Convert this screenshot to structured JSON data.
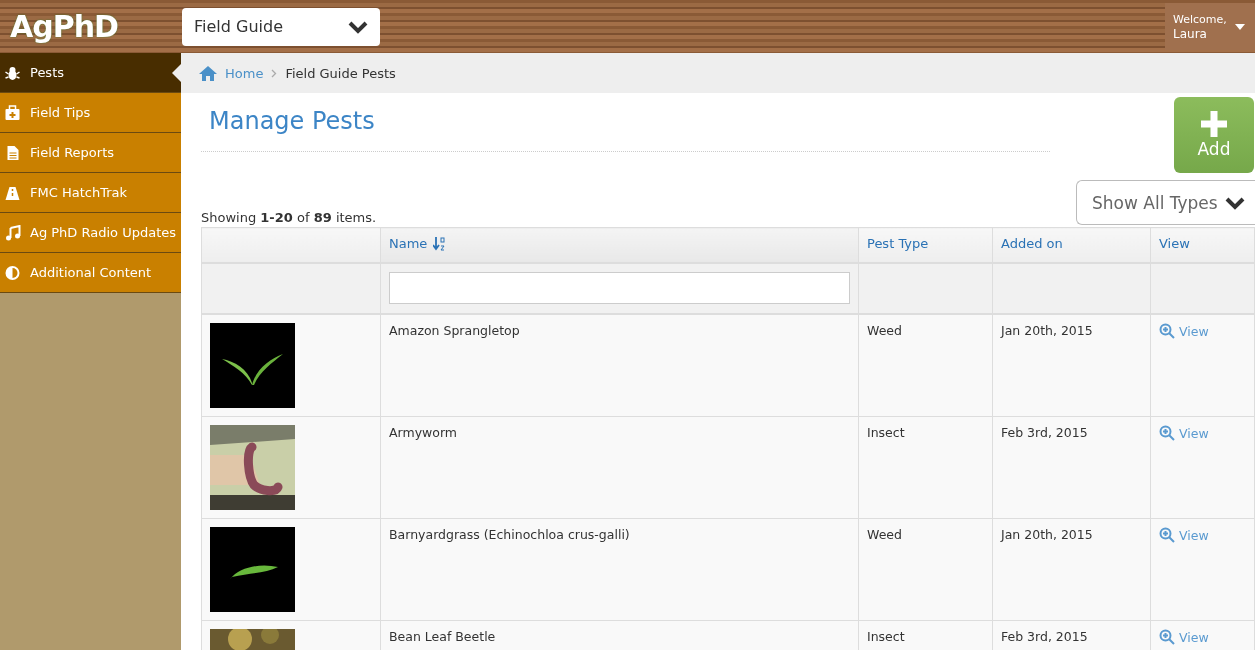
{
  "header": {
    "logo": "AgPhD",
    "guide_select": "Field Guide",
    "welcome": "Welcome,",
    "user": "Laura"
  },
  "sidebar": {
    "items": [
      {
        "label": "Pests",
        "selected": true
      },
      {
        "label": "Field Tips",
        "selected": false
      },
      {
        "label": "Field Reports",
        "selected": false
      },
      {
        "label": "FMC HatchTrak",
        "selected": false
      },
      {
        "label": "Ag PhD Radio Updates",
        "selected": false
      },
      {
        "label": "Additional Content",
        "selected": false
      }
    ]
  },
  "breadcrumb": [
    "Home",
    "Field Guide Pests"
  ],
  "page_title": "Manage Pests",
  "add_button": "Add",
  "type_filter": "Show All Types",
  "summary": "Showing **1-20** of **89** items.",
  "table": {
    "columns": [
      {
        "sortable": false
      },
      {
        "label": "Name",
        "sortable": true
      },
      {
        "label": "Pest Type",
        "sortable": false
      },
      {
        "label": "Added on",
        "sortable": false
      },
      {
        "label": "View",
        "sortable": false
      }
    ],
    "rows": [
      {
        "name": "Amazon Sprangletop",
        "type": "Weed",
        "added": "Jan 20th, 2015",
        "view": "View"
      },
      {
        "name": "Armyworm",
        "type": "Insect",
        "added": "Feb 3rd, 2015",
        "view": "View"
      },
      {
        "name": "Barnyardgrass (Echinochloa crus-galli)",
        "type": "Weed",
        "added": "Jan 20th, 2015",
        "view": "View"
      },
      {
        "name": "Bean Leaf Beetle",
        "type": "Insect",
        "added": "Feb 3rd, 2015",
        "view": "View"
      }
    ]
  }
}
